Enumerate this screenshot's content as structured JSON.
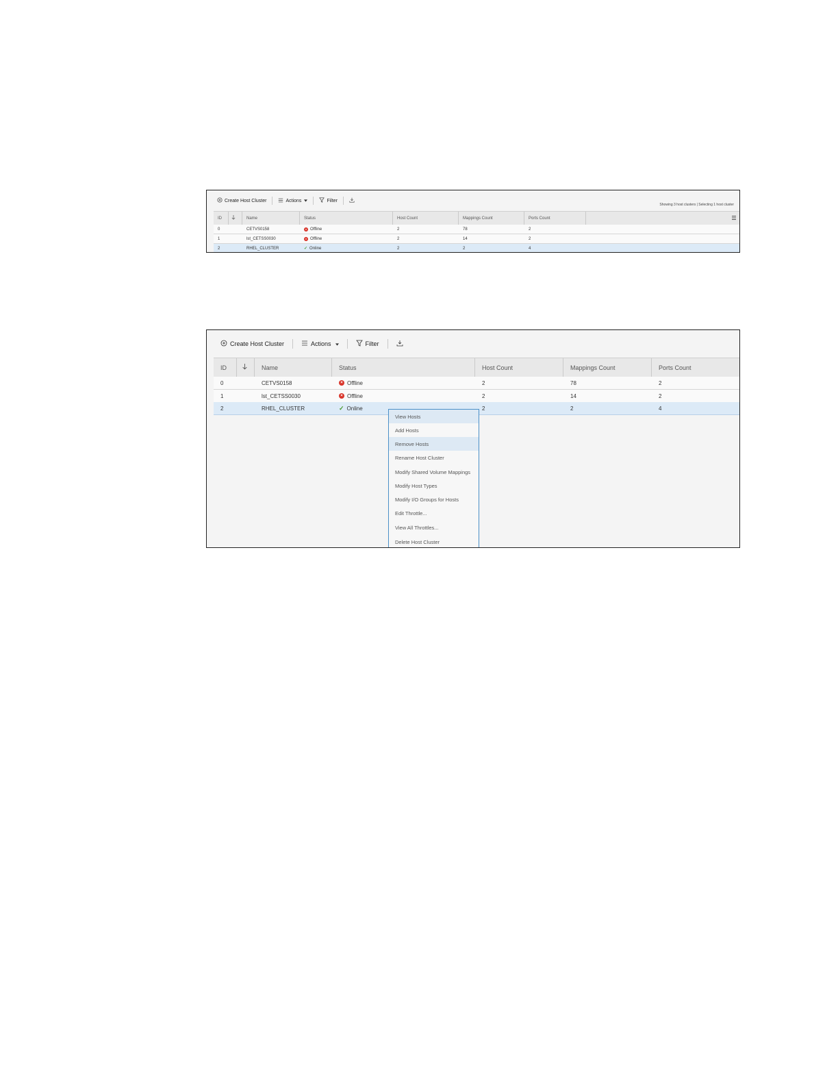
{
  "toolbar": {
    "create_label": "Create Host Cluster",
    "actions_label": "Actions",
    "filter_label": "Filter"
  },
  "summary_text": "Showing 3 host clusters | Selecting 1 host cluster",
  "columns": {
    "id": "ID",
    "name": "Name",
    "status": "Status",
    "host_count": "Host Count",
    "mappings_count": "Mappings Count",
    "ports_count": "Ports Count"
  },
  "rows": [
    {
      "id": "0",
      "name": "CETVS0158",
      "status": "Offline",
      "host_count": "2",
      "mappings_count": "78",
      "ports_count": "2"
    },
    {
      "id": "1",
      "name": "lst_CETSS0030",
      "status": "Offline",
      "host_count": "2",
      "mappings_count": "14",
      "ports_count": "2"
    },
    {
      "id": "2",
      "name": "RHEL_CLUSTER",
      "status": "Online",
      "host_count": "2",
      "mappings_count": "2",
      "ports_count": "4"
    }
  ],
  "context_menu": [
    "View Hosts",
    "Add Hosts",
    "Remove Hosts",
    "Rename Host Cluster",
    "Modify Shared Volume Mappings",
    "Modify Host Types",
    "Modify I/O Groups for Hosts",
    "Edit Throttle...",
    "View All Throttles...",
    "Delete Host Cluster"
  ],
  "colors": {
    "offline": "#d9352b",
    "online": "#4a9a2f",
    "selected_row": "#dceaf7",
    "menu_border": "#4a8fc7"
  },
  "icons": {
    "create": "plus-circle-icon",
    "actions": "list-icon",
    "filter": "filter-icon",
    "export": "download-icon",
    "sort": "arrow-down-icon",
    "columns": "column-settings-icon"
  }
}
